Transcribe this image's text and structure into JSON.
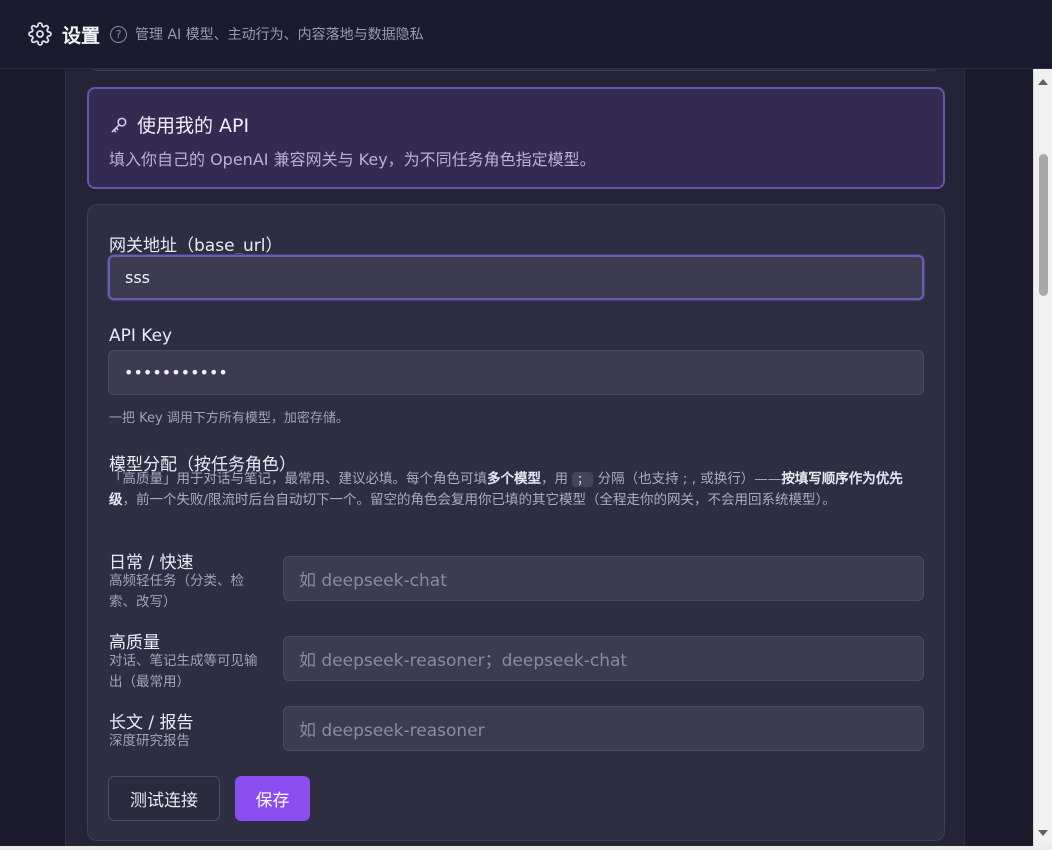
{
  "header": {
    "title": "设置",
    "subtitle": "管理 AI 模型、主动行为、内容落地与数据隐私",
    "help_glyph": "?"
  },
  "banner": {
    "icon": "key-icon",
    "title": "使用我的 API",
    "description": "填入你自己的 OpenAI 兼容网关与 Key，为不同任务角色指定模型。"
  },
  "form": {
    "base_url": {
      "label": "网关地址（base_url）",
      "value": "sss"
    },
    "api_key": {
      "label": "API Key",
      "value": "•••••••••••",
      "hint": "一把 Key 调用下方所有模型，加密存储。"
    },
    "models": {
      "label": "模型分配（按任务角色）",
      "desc_part1": "「高质量」用于对话与笔记，最常用、建议必填。每个角色可填",
      "desc_bold1": "多个模型",
      "desc_part2": "，用",
      "desc_code": "；",
      "desc_part3": "分隔（也支持 ; , 或换行）——",
      "desc_bold2": "按填写顺序作为优先级",
      "desc_part4": "，前一个失败/限流时后台自动切下一个。留空的角色会复用你已填的其它模型（全程走你的网关，不会用回系统模型）。",
      "roles": [
        {
          "name": "日常 / 快速",
          "desc": "高频轻任务（分类、检索、改写）",
          "placeholder": "如 deepseek-chat"
        },
        {
          "name": "高质量",
          "desc": "对话、笔记生成等可见输出（最常用）",
          "placeholder": "如 deepseek-reasoner；deepseek-chat"
        },
        {
          "name": "长文 / 报告",
          "desc": "深度研究报告",
          "placeholder": "如 deepseek-reasoner"
        }
      ]
    },
    "buttons": {
      "test": "测试连接",
      "save": "保存"
    }
  },
  "colors": {
    "accent": "#8b4df0",
    "banner_border": "#6a52b0",
    "background": "#1a1a2b"
  }
}
